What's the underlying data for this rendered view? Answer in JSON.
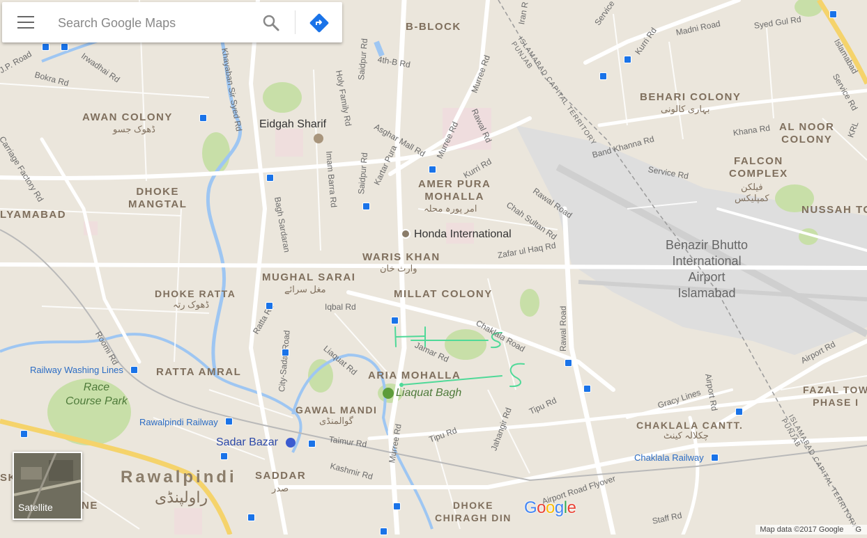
{
  "search": {
    "placeholder": "Search Google Maps"
  },
  "satellite_label": "Satellite",
  "attribution": "Map data ©2017 Google",
  "attribution_tail": "G",
  "google_logo": [
    "G",
    "o",
    "o",
    "g",
    "l",
    "e"
  ],
  "colors": {
    "land": "#ebe6dc",
    "road": "#ffffff",
    "highway": "#f5d36b",
    "water": "#9ec6f2",
    "park": "#c8dfa8",
    "airport": "#dedede",
    "transit_blue": "#1a73e8",
    "handwriting": "#4fd998"
  },
  "labels": {
    "b_block": "B-BLOCK",
    "awan_colony": "AWAN COLONY",
    "awan_colony_ur": "ڈھوک جسو",
    "eidgah_sharif": "Eidgah Sharif",
    "dhoke_mangtal": "DHOKE\nMANGTAL",
    "lyamabad": "LYAMABAD",
    "amer_pura": "AMER PURA\nMOHALLA",
    "amer_pura_ur": "امر پورہ محلہ",
    "honda": "Honda International",
    "waris_khan": "WARIS KHAN",
    "waris_khan_ur": "وارث خان",
    "mughal_sarai": "MUGHAL SARAI",
    "mughal_sarai_ur": "مغل سرائے",
    "dhoke_ratta": "DHOKE RATTA",
    "dhoke_ratta_ur": "ڈھوک رتہ",
    "millat_colony": "MILLAT COLONY",
    "behari_colony": "BEHARI COLONY",
    "behari_colony_ur": "بہاری کالونی",
    "al_noor": "AL NOOR\nCOLONY",
    "falcon_complex": "FALCON\nCOMPLEX",
    "falcon_complex_ur": "فیلکن\nکمپلیکس",
    "nussah": "NUSSAH TO",
    "airport": "Benazir Bhutto\nInternational\nAirport\nIslamabad",
    "ratta_amral": "RATTA AMRAL",
    "aria_mohalla": "ARIA MOHALLA",
    "liaquat_bagh": "Liaquat Bagh",
    "railway_washing": "Railway Washing Lines",
    "race_course": "Race\nCourse Park",
    "gawal_mandi": "GAWAL MANDI",
    "gawal_mandi_ur": "گوالمنڈی",
    "rawalpindi_railway": "Rawalpindi Railway",
    "sadar_bazar": "Sadar Bazar",
    "rawalpindi": "Rawalpindi",
    "rawalpindi_ur": "راولپنڈی",
    "saddar": "SADDAR",
    "saddar_ur": "صدر",
    "dhoke_chiragh": "DHOKE\nCHIRAGH DIN",
    "chaklala_cantt": "CHAKLALA CANTT.",
    "chaklala_cantt_ur": "چکلالہ کینٹ",
    "chaklala_railway": "Chaklala Railway",
    "fazal_town": "FAZAL TOW\nPHASE I",
    "ne": "NE",
    "sk": "SK"
  },
  "roads": {
    "jp_road": "J.P. Road",
    "bokra": "Bokra Rd",
    "irwadhai": "Irwadhai Rd",
    "khayaban": "Khayaban Sir Syed Rd",
    "holy_family": "Holy Family Rd",
    "saidpur1": "Saidpur Rd",
    "fourth_b": "4th-B Rd",
    "murree1": "Murree Rd",
    "asghar_mall": "Asghar Mall Rd",
    "rawal1": "Rawal Rd",
    "kartar": "Kartar Pura",
    "murree2": "Murree Rd",
    "imam_barra": "Imam Barra Rd",
    "saidpur2": "Saidpur Rd",
    "kurri": "Kurri Rd",
    "carriage": "Carriage Factory Rd",
    "bagh_sardaran": "Bagh Sardaran",
    "chah_sultan": "Chah Sultan Rd",
    "rawal2": "Rawal Road",
    "zafar": "Zafar ul Haq Rd",
    "iqbal": "Iqbal Rd",
    "ratta": "Ratta Rd",
    "city_sadar": "City-Sadar Road",
    "liaquat": "Liaquat Rd",
    "jamar": "Jamar Rd",
    "chaklala": "Chaklala Road",
    "rawal3": "Rawal Road",
    "roomi": "Roomi Rd",
    "tipu1": "Tipu Rd",
    "tipu2": "Tipu Rd",
    "jahangir": "Jahangir Rd",
    "taimur": "Taimur Rd",
    "kashmir": "Kashmir Rd",
    "murree3": "Murree Rd",
    "airport_flyover": "Airport Road Flyover",
    "airport_rd": "Airport Rd",
    "airport_rd2": "Airport Rd",
    "gracy": "Gracy Lines",
    "staff": "Staff Rd",
    "madni": "Madni Road",
    "syed_gul": "Syed Gul Rd",
    "kurri2": "Kurri Rd",
    "service1": "Service",
    "service2": "Service Rd",
    "service3": "Service Rd",
    "khana": "Khana Rd",
    "band_khanna": "Band Khanna Rd",
    "krl": "KRL",
    "islamabad_hwy": "Islamabad",
    "iran": "Iran R",
    "ict1": "ISLAMABAD CAPITAL TERRITORY\nPUNJAB",
    "ict2": "ISLAMABAD CAPITAL TERRITORY\nPUNJAB",
    "ict3": "ICT"
  }
}
